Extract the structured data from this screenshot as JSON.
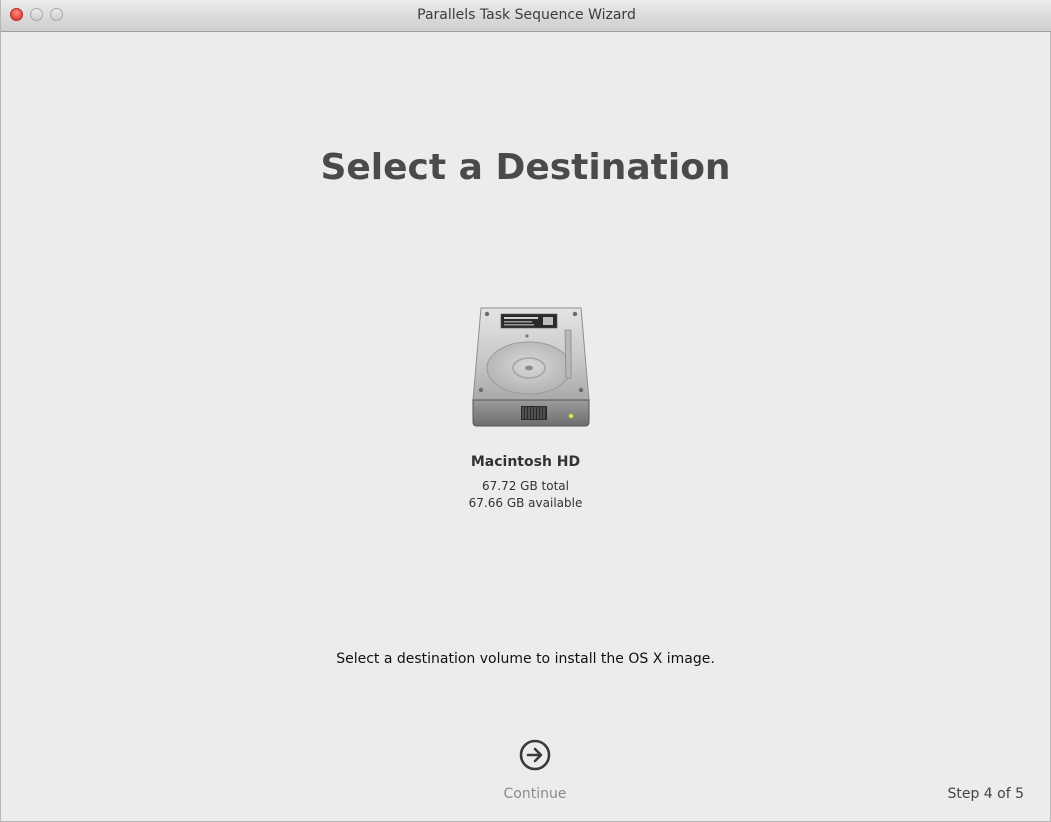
{
  "window": {
    "title": "Parallels Task Sequence Wizard"
  },
  "page": {
    "heading": "Select a Destination",
    "instruction": "Select a destination volume to install the OS X image."
  },
  "volume": {
    "name": "Macintosh HD",
    "total": "67.72 GB total",
    "available": "67.66 GB available",
    "icon": "hard-drive-icon"
  },
  "footer": {
    "continue_label": "Continue",
    "continue_icon": "arrow-right-circle-icon",
    "step": "Step 4 of 5"
  },
  "colors": {
    "close_button": "#f0524a",
    "window_background": "#ececec",
    "heading_text": "#4a4a4a",
    "continue_disabled_text": "#8a8a8a"
  }
}
